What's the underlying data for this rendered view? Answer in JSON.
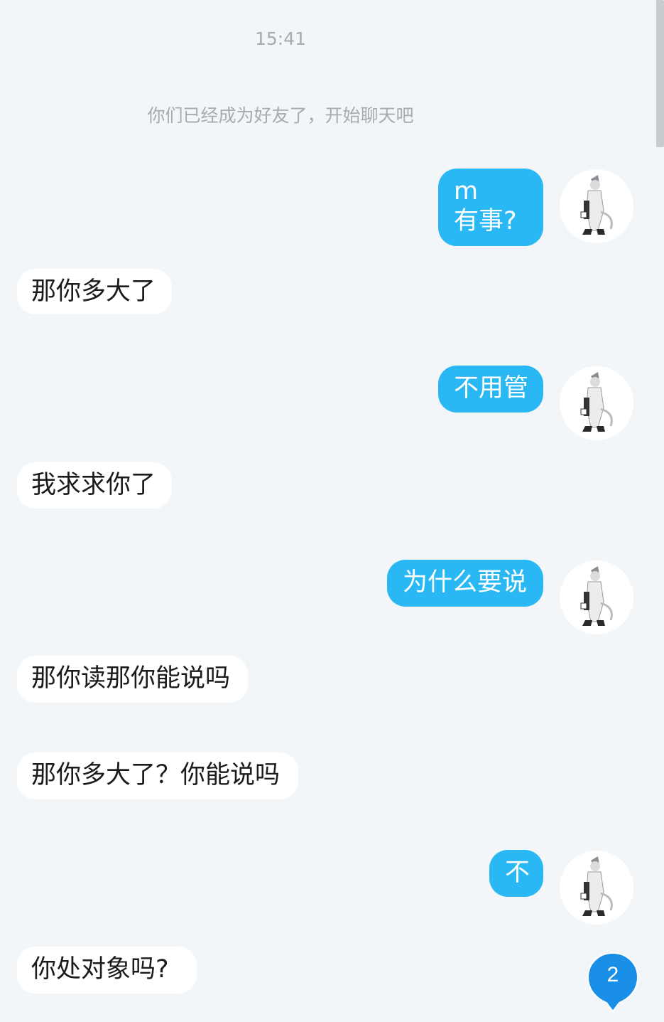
{
  "chat": {
    "timestamp": "15:41",
    "system_notice": "你们已经成为好友了，开始聊天吧",
    "messages": [
      {
        "side": "out",
        "text": "m\n有事?"
      },
      {
        "side": "in",
        "text": "那你多大了"
      },
      {
        "side": "out",
        "text": "不用管"
      },
      {
        "side": "in",
        "text": "我求求你了"
      },
      {
        "side": "out",
        "text": "为什么要说"
      },
      {
        "side": "in",
        "text": "那你读那你能说吗"
      },
      {
        "side": "in",
        "text": "那你多大了？你能说吗"
      },
      {
        "side": "out",
        "text": "不"
      },
      {
        "side": "in",
        "text": "你处对象吗?"
      }
    ]
  },
  "unread_badge": {
    "count": "2"
  },
  "colors": {
    "background": "#f2f6f8",
    "outgoing_bubble": "#2ab8f5",
    "incoming_bubble": "#ffffff",
    "badge": "#1a8fe8",
    "muted_text": "#a7abaf"
  },
  "icons": {
    "avatar": "avatar-icon",
    "badge": "unread-badge-icon"
  }
}
